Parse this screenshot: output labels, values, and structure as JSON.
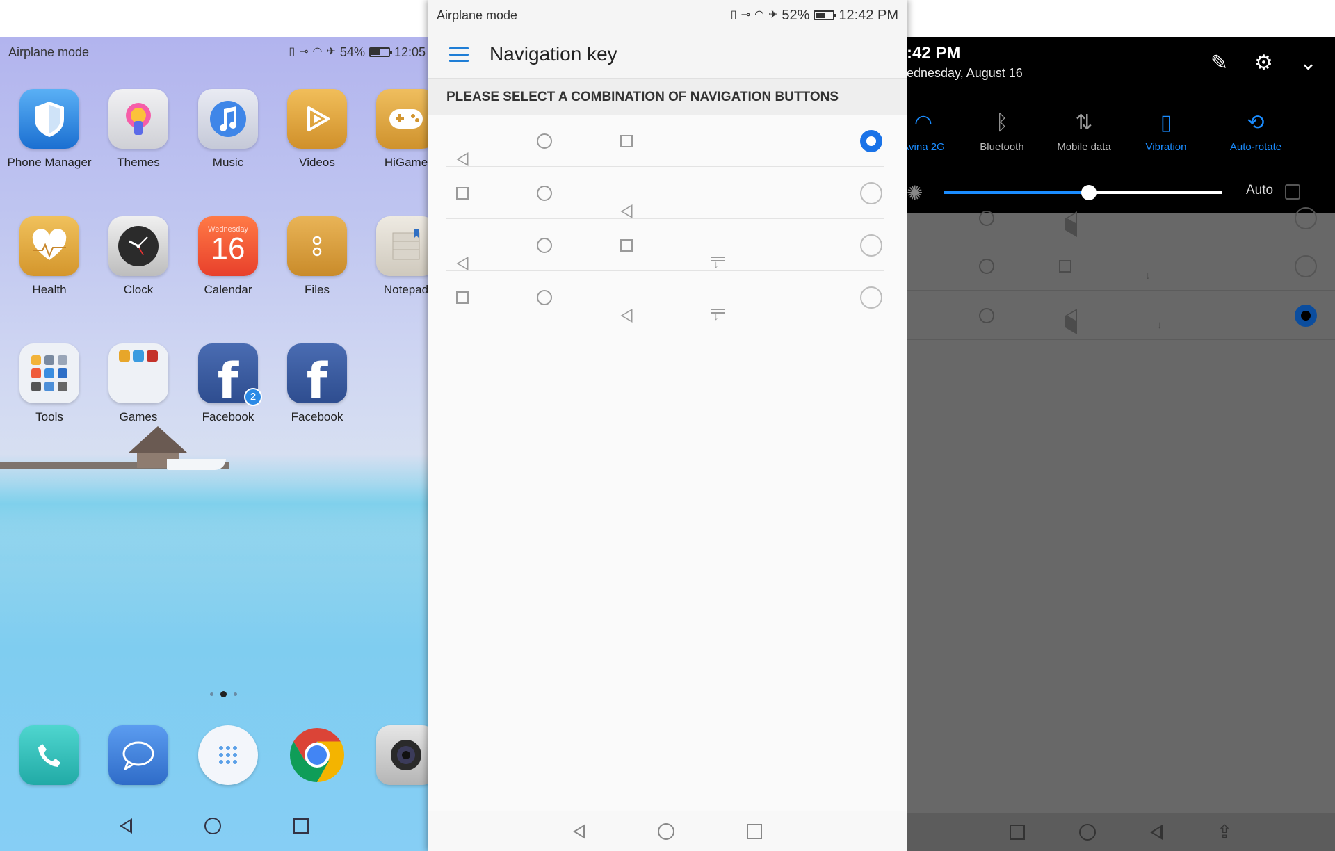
{
  "left_phone": {
    "status": {
      "mode": "Airplane mode",
      "battery": "54%",
      "time": "12:05",
      "battery_level": 0.54
    },
    "apps": [
      {
        "label": "Phone Manager",
        "icon": "shield-icon",
        "color": "#2f8be6"
      },
      {
        "label": "Themes",
        "icon": "paintbrush-icon",
        "color": "#e3e3e6"
      },
      {
        "label": "Music",
        "icon": "music-note-icon",
        "color": "#d8dbe8"
      },
      {
        "label": "Videos",
        "icon": "play-icon",
        "color": "#e0a83a"
      },
      {
        "label": "HiGame",
        "icon": "gamepad-icon",
        "color": "#e0a83a"
      },
      {
        "label": "Health",
        "icon": "heart-icon",
        "color": "#e0ad3e"
      },
      {
        "label": "Clock",
        "icon": "clock-icon",
        "color": "#dcdcdc"
      },
      {
        "label": "Calendar",
        "icon": "calendar-icon",
        "color": "#f2522f",
        "day_name": "Wednesday",
        "day_number": "16"
      },
      {
        "label": "Files",
        "icon": "folder-icon",
        "color": "#dba03c"
      },
      {
        "label": "Notepad",
        "icon": "notepad-icon",
        "color": "#e7e3dc"
      },
      {
        "label": "Tools",
        "icon": "tools-folder-icon",
        "color": "#eceff4"
      },
      {
        "label": "Games",
        "icon": "games-folder-icon",
        "color": "#eceff4"
      },
      {
        "label": "Facebook",
        "icon": "facebook-icon",
        "color": "#3b5998",
        "badge": "2"
      },
      {
        "label": "Facebook",
        "icon": "facebook-icon",
        "color": "#3b5998"
      }
    ],
    "dock": [
      {
        "icon": "phone-icon",
        "color": "#35c6c1"
      },
      {
        "icon": "message-icon",
        "color": "#3a7fd9"
      },
      {
        "icon": "app-drawer-icon",
        "color": "#f4f7fb"
      },
      {
        "icon": "chrome-icon",
        "color": "#ffffff"
      },
      {
        "icon": "camera-icon",
        "color": "#cfcfcf"
      }
    ]
  },
  "mid_phone": {
    "status": {
      "mode": "Airplane mode",
      "battery": "52%",
      "time": "12:42 PM",
      "battery_level": 0.52
    },
    "title": "Navigation key",
    "section_header": "PLEASE SELECT A COMBINATION OF NAVIGATION BUTTONS",
    "options": [
      {
        "buttons": [
          "back",
          "home",
          "recent"
        ],
        "selected": true
      },
      {
        "buttons": [
          "recent",
          "home",
          "back"
        ],
        "selected": false
      },
      {
        "buttons": [
          "back",
          "home",
          "recent",
          "notifications"
        ],
        "selected": false
      },
      {
        "buttons": [
          "recent",
          "home",
          "back",
          "notifications"
        ],
        "selected": false
      }
    ],
    "accent": "#1a73e8"
  },
  "right_phone": {
    "time": ":42 PM",
    "date": "ednesday, August 16",
    "quick_settings": [
      {
        "label": "Avina 2G",
        "icon": "wifi-icon",
        "active": true
      },
      {
        "label": "Bluetooth",
        "icon": "bluetooth-icon",
        "active": false
      },
      {
        "label": "Mobile data",
        "icon": "mobile-data-icon",
        "active": false
      },
      {
        "label": "Vibration",
        "icon": "vibration-icon",
        "active": true
      },
      {
        "label": "Auto-rotate",
        "icon": "auto-rotate-icon",
        "active": true
      }
    ],
    "brightness_level": 0.52,
    "auto_label": "Auto",
    "active_color": "#1a8cff"
  }
}
